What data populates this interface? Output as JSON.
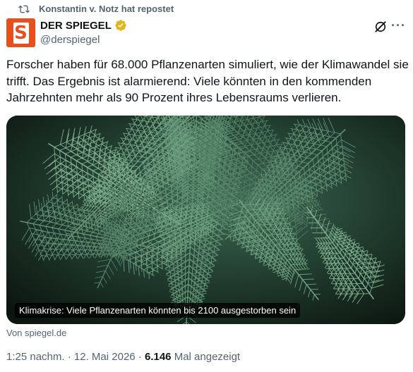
{
  "repost": {
    "text": "Konstantin v. Notz hat repostet",
    "icon": "repost-icon"
  },
  "author": {
    "name": "DER SPIEGEL",
    "handle": "@derspiegel",
    "avatar_letter": "S",
    "verified": true,
    "avatar_color": "#e84f1c",
    "badge_color": "#e2b719"
  },
  "tweet": {
    "text": "Forscher haben für 68.000 Pflanzenarten simuliert, wie der Klimawandel sie trifft. Das Ergebnis ist alarmierend: Viele könnten in den kommenden Jahrzehnten mehr als 90 Prozent ihres Lebensraums verlieren."
  },
  "card": {
    "caption": "Klimakrise: Viele Pflanzenarten könnten bis 2100 ausgestorben sein",
    "source": "Von spiegel.de"
  },
  "meta": {
    "time": "1:25 nachm.",
    "date": "12. Mai 2026",
    "views": "6.146",
    "views_label": "Mal angezeigt",
    "separator": "·"
  },
  "actions": {
    "more": "···"
  }
}
